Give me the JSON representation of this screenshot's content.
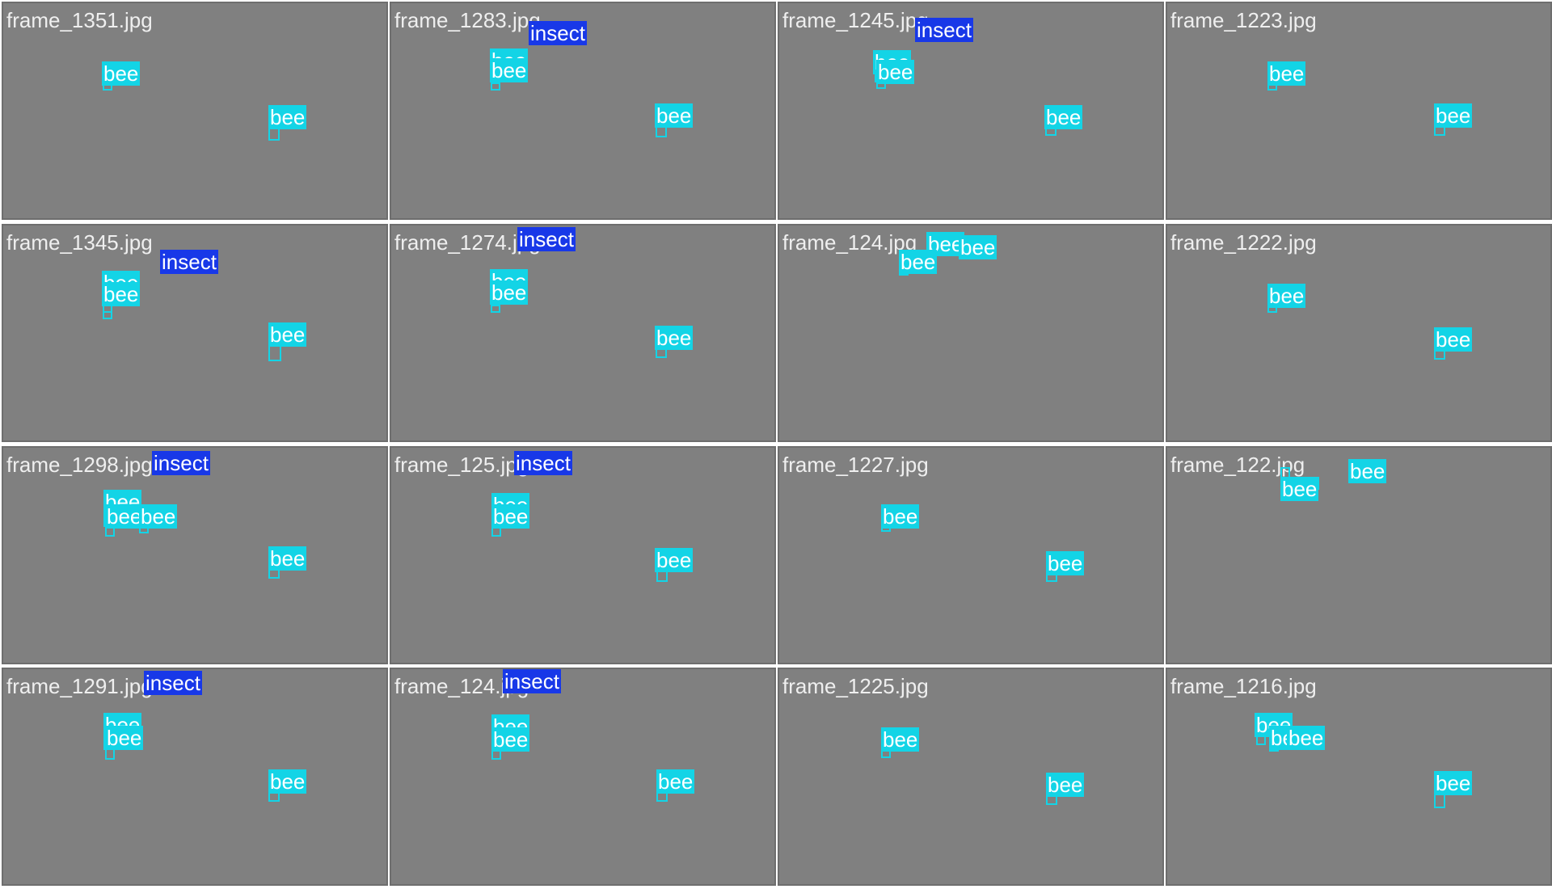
{
  "class_colors": {
    "bee": "#13d4e6",
    "insect": "#1838e8"
  },
  "tiles": [
    {
      "filename": "frame_1351.jpg",
      "detections": [
        {
          "label": "bee"
        },
        {
          "label": "bee"
        }
      ]
    },
    {
      "filename": "frame_1283.jpg",
      "detections": [
        {
          "label": "bee"
        },
        {
          "label": "bee"
        },
        {
          "label": "insect"
        },
        {
          "label": "bee"
        }
      ]
    },
    {
      "filename": "frame_1245.jpg",
      "detections": [
        {
          "label": "bee"
        },
        {
          "label": "bee"
        },
        {
          "label": "insect"
        },
        {
          "label": "bee"
        }
      ]
    },
    {
      "filename": "frame_1223.jpg",
      "detections": [
        {
          "label": "bee"
        },
        {
          "label": "bee"
        }
      ]
    },
    {
      "filename": "frame_1345.jpg",
      "detections": [
        {
          "label": "bee"
        },
        {
          "label": "bee"
        },
        {
          "label": "insect"
        },
        {
          "label": "bee"
        }
      ]
    },
    {
      "filename": "frame_1274.jpg",
      "detections": [
        {
          "label": "bee"
        },
        {
          "label": "bee"
        },
        {
          "label": "insect"
        },
        {
          "label": "bee"
        }
      ]
    },
    {
      "filename": "frame_124.jpg",
      "detections": [
        {
          "label": "bee"
        },
        {
          "label": "bee"
        },
        {
          "label": "bee"
        }
      ]
    },
    {
      "filename": "frame_1222.jpg",
      "detections": [
        {
          "label": "bee"
        },
        {
          "label": "bee"
        }
      ]
    },
    {
      "filename": "frame_1298.jpg",
      "detections": [
        {
          "label": "bee"
        },
        {
          "label": "bee"
        },
        {
          "label": "bee"
        },
        {
          "label": "insect"
        },
        {
          "label": "bee"
        }
      ]
    },
    {
      "filename": "frame_125.jpg",
      "detections": [
        {
          "label": "bee"
        },
        {
          "label": "bee"
        },
        {
          "label": "insect"
        },
        {
          "label": "bee"
        }
      ]
    },
    {
      "filename": "frame_1227.jpg",
      "detections": [
        {
          "label": "bee"
        },
        {
          "label": "bee"
        }
      ]
    },
    {
      "filename": "frame_122.jpg",
      "detections": [
        {
          "label": "bee"
        },
        {
          "label": "bee"
        },
        {
          "label": "bee"
        }
      ]
    },
    {
      "filename": "frame_1291.jpg",
      "detections": [
        {
          "label": "bee"
        },
        {
          "label": "bee"
        },
        {
          "label": "insect"
        },
        {
          "label": "bee"
        }
      ]
    },
    {
      "filename": "frame_124.jpg",
      "detections": [
        {
          "label": "bee"
        },
        {
          "label": "bee"
        },
        {
          "label": "insect"
        },
        {
          "label": "bee"
        }
      ]
    },
    {
      "filename": "frame_1225.jpg",
      "detections": [
        {
          "label": "bee"
        },
        {
          "label": "bee"
        }
      ]
    },
    {
      "filename": "frame_1216.jpg",
      "detections": [
        {
          "label": "bee"
        },
        {
          "label": "bee"
        },
        {
          "label": "bee"
        },
        {
          "label": "bee"
        }
      ]
    }
  ]
}
